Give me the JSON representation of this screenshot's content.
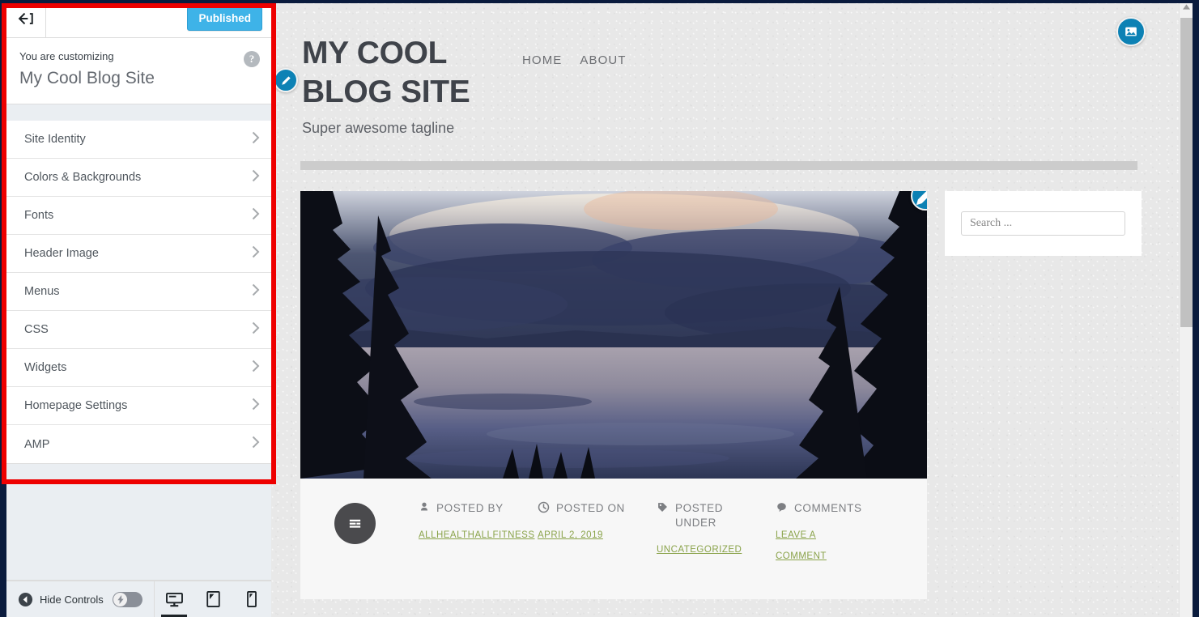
{
  "customizer": {
    "back_icon": "back-arrow-icon",
    "publish_button": "Published",
    "help_icon": "help-icon",
    "customizing_label": "You are customizing",
    "site_name": "My Cool Blog Site",
    "panels": [
      {
        "label": "Site Identity"
      },
      {
        "label": "Colors & Backgrounds"
      },
      {
        "label": "Fonts"
      },
      {
        "label": "Header Image"
      },
      {
        "label": "Menus"
      },
      {
        "label": "CSS"
      },
      {
        "label": "Widgets"
      },
      {
        "label": "Homepage Settings"
      },
      {
        "label": "AMP"
      }
    ],
    "footer": {
      "hide_controls_label": "Hide Controls",
      "hide_icon": "collapse-left-icon",
      "amp_toggle_icon": "lightning-bolt-icon",
      "amp_toggle_on": false,
      "devices": [
        {
          "name": "desktop",
          "icon": "desktop-icon",
          "active": true
        },
        {
          "name": "tablet",
          "icon": "tablet-icon",
          "active": false
        },
        {
          "name": "mobile",
          "icon": "mobile-icon",
          "active": false
        }
      ]
    }
  },
  "preview": {
    "site_title": "MY COOL BLOG SITE",
    "tagline": "Super awesome tagline",
    "nav": [
      {
        "label": "HOME"
      },
      {
        "label": "ABOUT"
      }
    ],
    "featured_image_alt": "Lake at dusk with silhouetted evergreen trees and dramatic clouds",
    "post_format_icon": "post-lines-icon",
    "meta": [
      {
        "icon": "person-icon",
        "label": "POSTED BY",
        "value": "ALLHEALTHALLFITNESS"
      },
      {
        "icon": "clock-icon",
        "label": "POSTED ON",
        "value": "APRIL 2, 2019"
      },
      {
        "icon": "tag-icon",
        "label": "POSTED UNDER",
        "value": "UNCATEGORIZED"
      },
      {
        "icon": "comment-icon",
        "label": "COMMENTS",
        "value": "LEAVE A COMMENT"
      }
    ],
    "search_widget": {
      "placeholder": "Search ...",
      "value": ""
    },
    "edit_shortcuts": [
      {
        "name": "edit-site-title-shortcut",
        "icon": "pencil-icon"
      },
      {
        "name": "edit-header-image-shortcut",
        "icon": "image-icon"
      },
      {
        "name": "edit-widget-shortcut",
        "icon": "pencil-icon"
      }
    ]
  },
  "colors": {
    "accent_blue": "#3eb3e8",
    "shortcut_blue": "#0d82b5",
    "highlight_red": "#ee0000",
    "meta_green": "#8aa34a",
    "chrome_navy": "#0a1b3d"
  }
}
